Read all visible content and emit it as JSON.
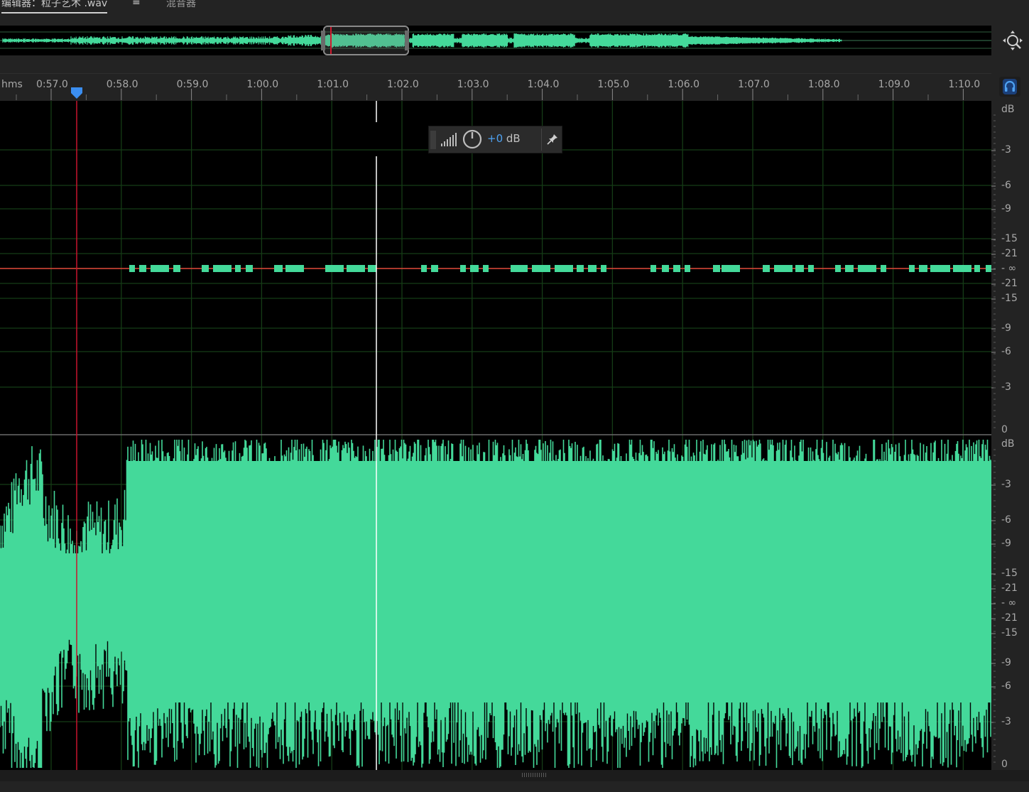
{
  "tabs": {
    "editor_label": "编辑器：粒子艺术 .wav",
    "mixer_label": "混音器"
  },
  "ruler": {
    "unit": "hms",
    "ticks": [
      "0:57.0",
      "0:58.0",
      "0:59.0",
      "1:00.0",
      "1:01.0",
      "1:02.0",
      "1:03.0",
      "1:04.0",
      "1:05.0",
      "1:06.0",
      "1:07.0",
      "1:08.0",
      "1:09.0",
      "1:10.0"
    ]
  },
  "db_scale": {
    "unit": "dB",
    "labels": [
      "-3",
      "-6",
      "-9",
      "-15",
      "-21",
      "- ∞",
      "-21",
      "-15",
      "-9",
      "-6",
      "-3"
    ],
    "zero": "0"
  },
  "hud": {
    "value": "+0",
    "unit": " dB"
  },
  "icons": {
    "zoom_navigator": "zoom-navigator-icon",
    "monitor": "headphones-icon",
    "level_bars": "level-bars-icon",
    "volume_knob": "knob-icon",
    "pin": "pin-icon"
  },
  "colors": {
    "waveform": "#44d99a",
    "playhead": "#c8142d",
    "cursor": "#ffffff",
    "center_line": "#e24a3a",
    "accent": "#4ea2f2",
    "grid": "#153c16"
  }
}
